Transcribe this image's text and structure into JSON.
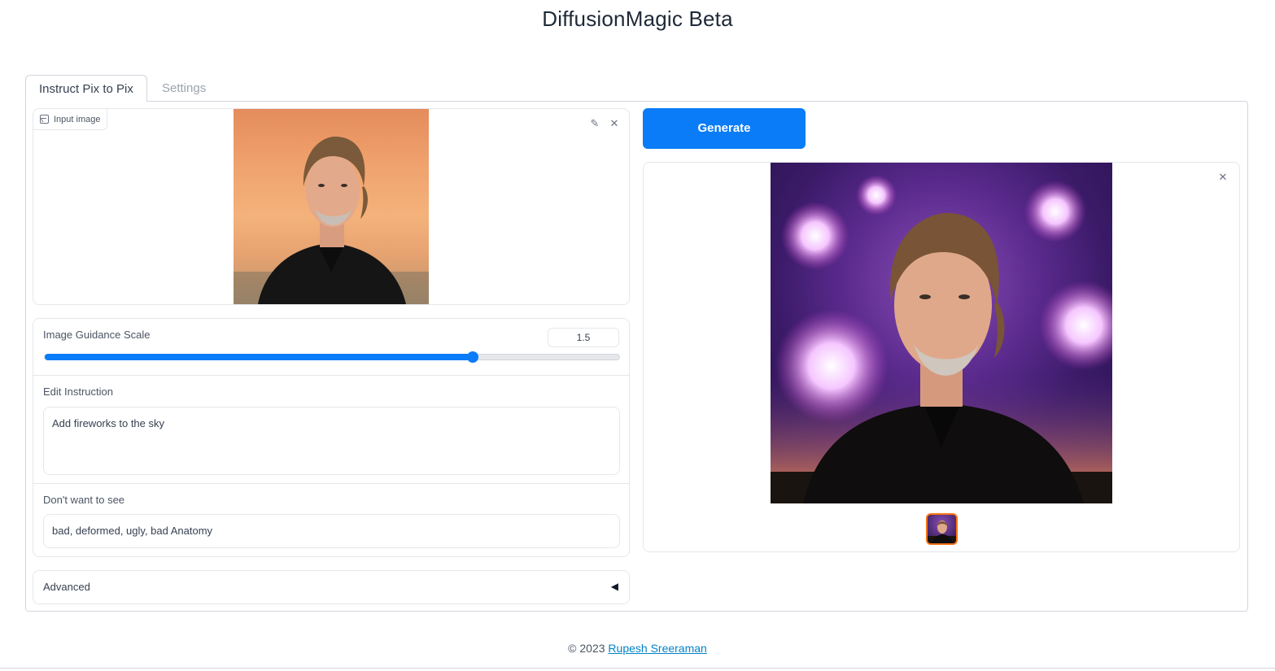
{
  "header": {
    "title": "DiffusionMagic Beta"
  },
  "tabs": [
    {
      "label": "Instruct Pix to Pix",
      "active": true
    },
    {
      "label": "Settings",
      "active": false
    }
  ],
  "input_image": {
    "label": "Input image",
    "edit_icon": "pencil-icon",
    "close_icon": "close-icon"
  },
  "image_guidance": {
    "label": "Image Guidance Scale",
    "value": "1.5",
    "slider_fraction": 0.745
  },
  "edit_instruction": {
    "label": "Edit Instruction",
    "value": "Add fireworks to the sky"
  },
  "negative_prompt": {
    "label": "Don't want to see",
    "value": "bad, deformed, ugly, bad Anatomy"
  },
  "advanced": {
    "label": "Advanced",
    "arrow": "◀"
  },
  "generate": {
    "label": "Generate"
  },
  "colors": {
    "accent": "#0a7cf7",
    "thumb_border": "#f97316",
    "link": "#0284c7"
  },
  "footer": {
    "copyright": "© 2023",
    "author": "Rupesh Sreeraman"
  }
}
